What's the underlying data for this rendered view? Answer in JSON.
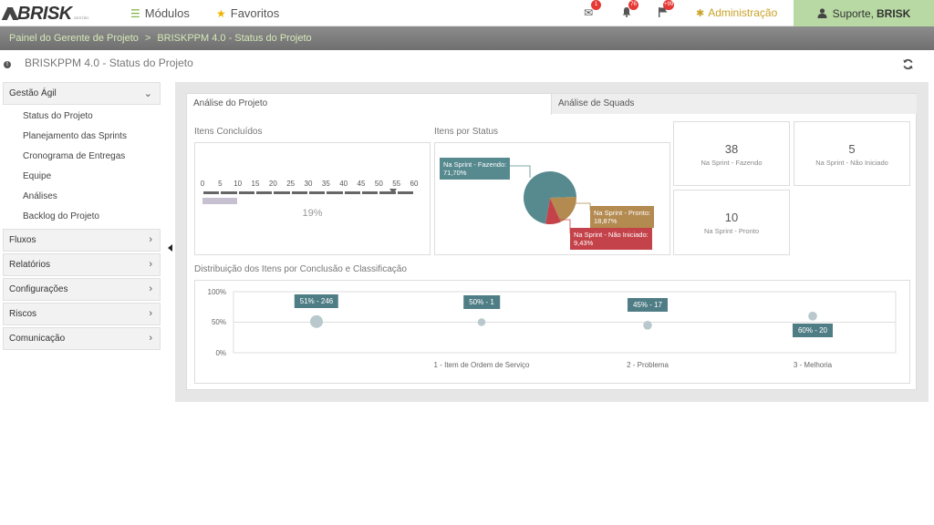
{
  "app": {
    "logo_text": "BRISK",
    "logo_sub": "GESTÃO",
    "modules_label": "Módulos",
    "favorites_label": "Favoritos",
    "mail_badge": "1",
    "bell_badge": "76",
    "flag_badge": "+99",
    "admin_label": "Administração",
    "support_prefix": "Suporte, ",
    "support_user": "BRISK"
  },
  "breadcrumb": {
    "items": [
      "Painel do Gerente de Projeto",
      "BRISKPPM 4.0 - Status do Projeto"
    ],
    "separator": ">"
  },
  "page": {
    "title": "BRISKPPM 4.0 - Status do Projeto"
  },
  "sidebar": {
    "groups": [
      {
        "label": "Gestão Ágil",
        "expanded": true,
        "items": [
          "Status do Projeto",
          "Planejamento das Sprints",
          "Cronograma de Entregas",
          "Equipe",
          "Análises",
          "Backlog do Projeto"
        ]
      },
      {
        "label": "Fluxos"
      },
      {
        "label": "Relatórios"
      },
      {
        "label": "Configurações"
      },
      {
        "label": "Riscos"
      },
      {
        "label": "Comunicação"
      }
    ]
  },
  "tabs": [
    "Análise do Projeto",
    "Análise de Squads"
  ],
  "itens_concluidos": {
    "label": "Itens Concluídos",
    "ticks": [
      "0",
      "5",
      "10",
      "15",
      "20",
      "25",
      "30",
      "35",
      "40",
      "45",
      "50",
      "55",
      "60"
    ],
    "progress_percent": 19,
    "progress_text": "19%",
    "target_value": 54
  },
  "itens_por_status": {
    "label": "Itens por Status",
    "chart_data": {
      "type": "pie",
      "slices": [
        {
          "label": "Na Sprint - Fazendo:",
          "pct_text": "71,70%",
          "value": 71.7,
          "color": "#578a8f"
        },
        {
          "label": "Na Sprint - Pronto:",
          "pct_text": "18,87%",
          "value": 18.87,
          "color": "#b38a50"
        },
        {
          "label": "Na Sprint - Não Iniciado:",
          "pct_text": "9,43%",
          "value": 9.43,
          "color": "#c4434a"
        }
      ]
    }
  },
  "stats": [
    {
      "value": "38",
      "label": "Na Sprint - Fazendo"
    },
    {
      "value": "5",
      "label": "Na Sprint - Não Iniciado"
    },
    {
      "value": "10",
      "label": "Na Sprint - Pronto"
    }
  ],
  "distribuicao": {
    "label": "Distribuição dos Itens por Conclusão e Classificação",
    "chart_data": {
      "type": "scatter",
      "yticks": [
        "100%",
        "50%",
        "0%"
      ],
      "ylim": [
        0,
        100
      ],
      "categories": [
        "",
        "1 - Item de Ordem de Serviço",
        "2 - Problema",
        "3 - Melhoria"
      ],
      "points": [
        {
          "category": 0,
          "y": 51,
          "label": "51% - 246",
          "count": 246
        },
        {
          "category": 1,
          "y": 50,
          "label": "50% - 1",
          "count": 1
        },
        {
          "category": 2,
          "y": 45,
          "label": "45% - 17",
          "count": 17
        },
        {
          "category": 3,
          "y": 60,
          "label": "60% - 20",
          "count": 20
        }
      ]
    }
  }
}
